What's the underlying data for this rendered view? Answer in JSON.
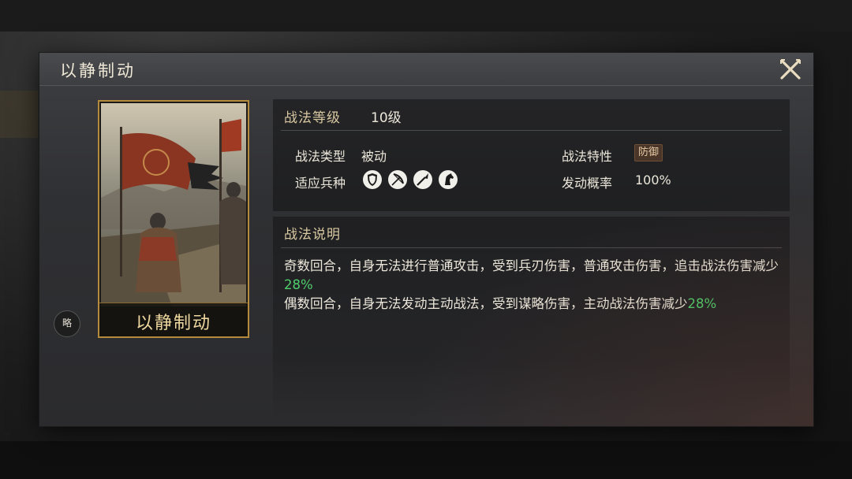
{
  "dialog": {
    "title": "以静制动"
  },
  "card": {
    "name": "以静制动",
    "badge": "略"
  },
  "level": {
    "label": "战法等级",
    "value": "10级"
  },
  "attributes": {
    "type_label": "战法类型",
    "type_value": "被动",
    "trait_label": "战法特性",
    "trait_value": "防御",
    "troops_label": "适应兵种",
    "rate_label": "发动概率",
    "rate_value": "100%",
    "troop_icons": [
      "shield-icon",
      "bow-icon",
      "spear-icon",
      "horse-icon"
    ]
  },
  "description": {
    "title": "战法说明",
    "line1_text": "奇数回合，自身无法进行普通攻击，受到兵刃伤害，普通攻击伤害，追击战法伤害减少",
    "line1_value": "28%",
    "line2_text": "偶数回合，自身无法发动主动战法，受到谋略伤害，主动战法伤害减少",
    "line2_value": "28%"
  },
  "colors": {
    "highlight": "#4fce6c",
    "card_border": "#b58a3c",
    "trait_tag_bg": "#4a3628"
  }
}
